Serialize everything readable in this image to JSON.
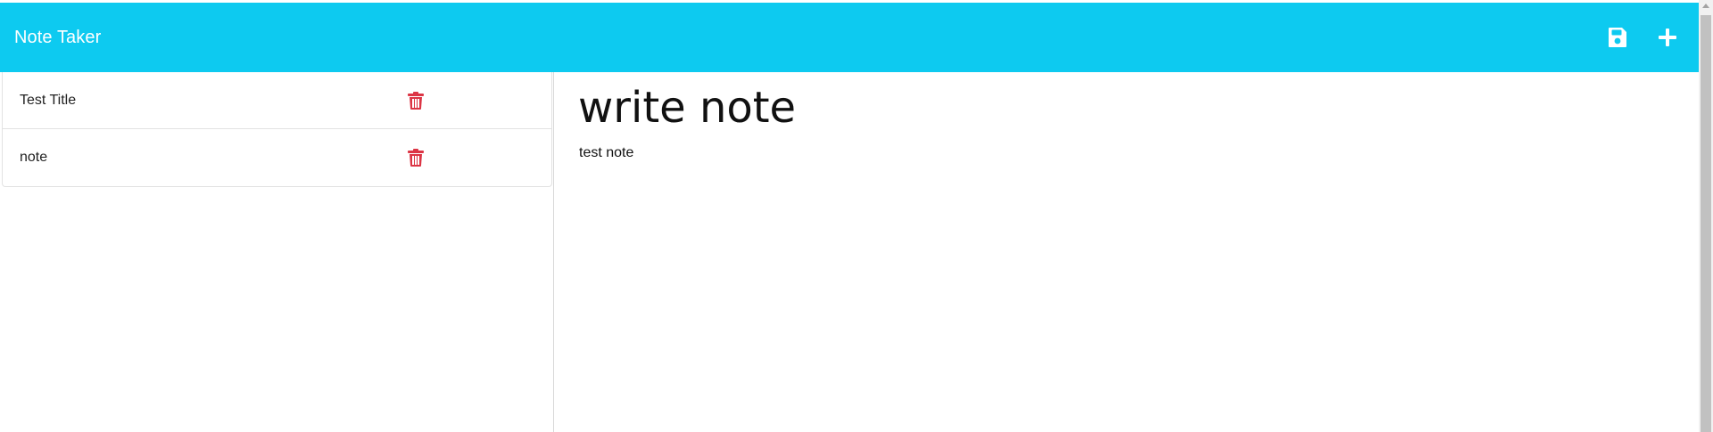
{
  "app": {
    "title": "Note Taker"
  },
  "toolbar": {
    "save_icon": "floppy-disk-icon",
    "new_icon": "plus-icon"
  },
  "notes": [
    {
      "title": "Test Title",
      "delete_icon": "trash-icon"
    },
    {
      "title": "note",
      "delete_icon": "trash-icon"
    }
  ],
  "editor": {
    "title": "write note",
    "body": "test note"
  },
  "colors": {
    "navbar": "#0dcaf0",
    "delete": "#dc3545",
    "icon": "#ffffff"
  }
}
